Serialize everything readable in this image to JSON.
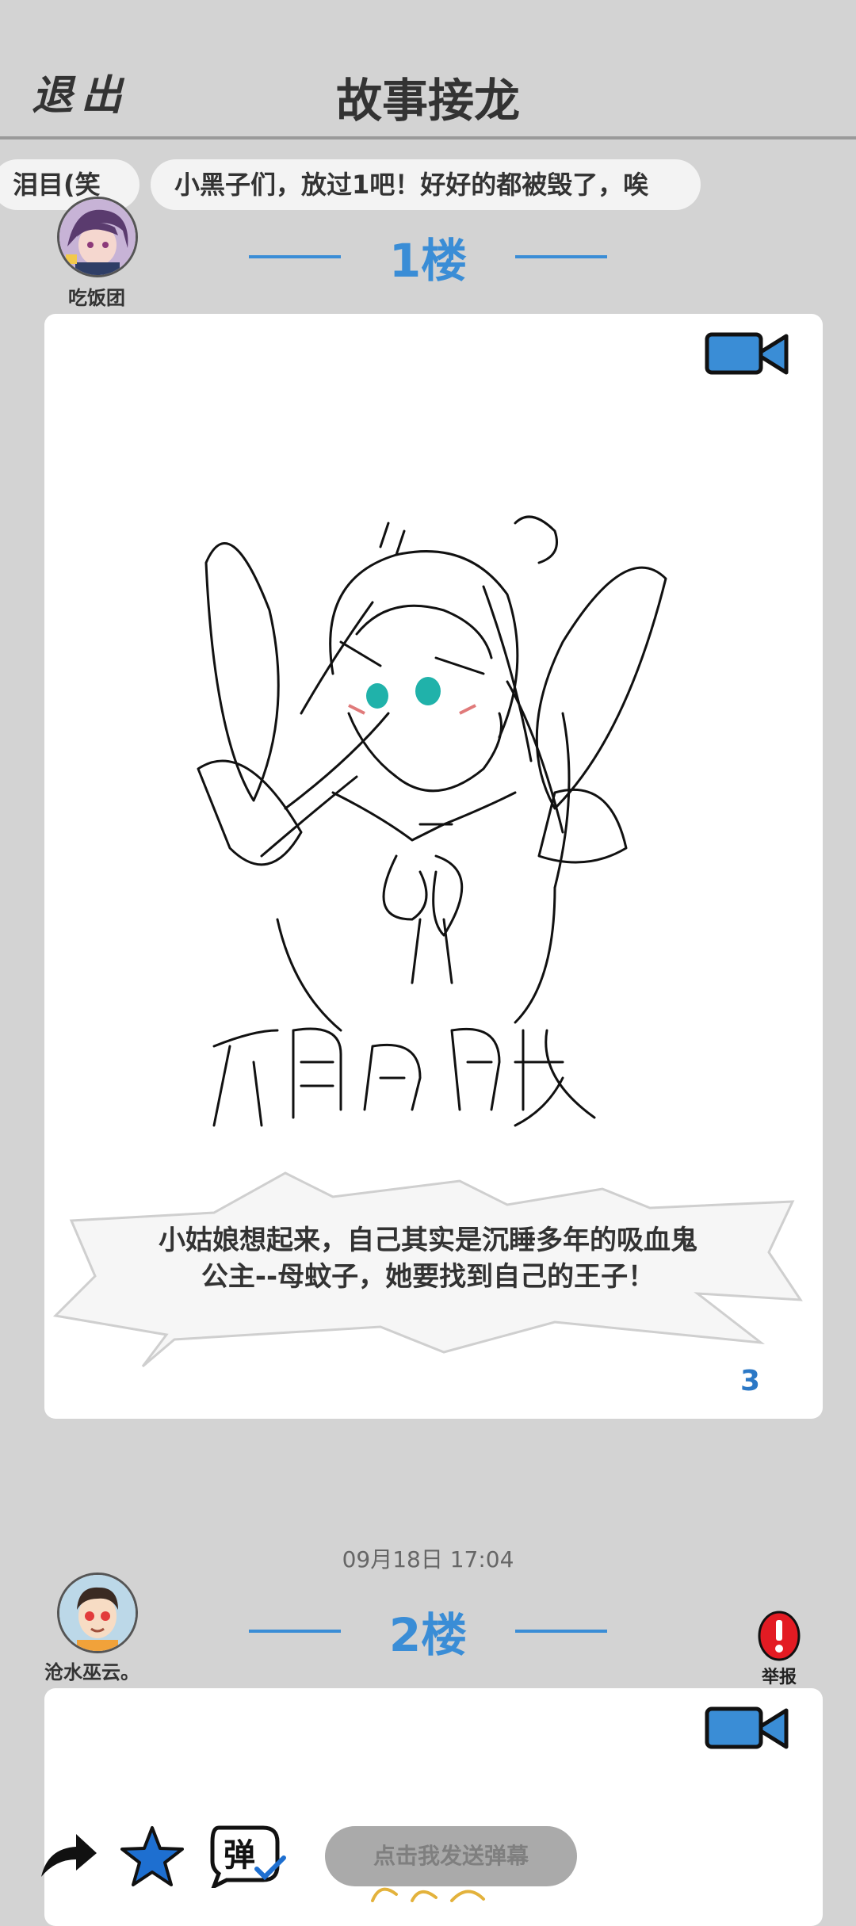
{
  "header": {
    "exit_label": "退出",
    "title": "故事接龙"
  },
  "danmaku": [
    "泪目(笑",
    "小黑子们，放过1吧！好好的都被毁了，唉"
  ],
  "floors": [
    {
      "username": "吃饭团",
      "floor_label": "1楼",
      "drawing_text": "希的睡魔",
      "caption_line1": "小姑娘想起来，自己其实是沉睡多年的吸血鬼",
      "caption_line2": "公主--母蚊子，她要找到自己的王子！",
      "page_count": "3"
    },
    {
      "timestamp": "09月18日  17:04",
      "username": "沧水巫云。",
      "floor_label": "2楼",
      "report_label": "举报"
    }
  ],
  "toolbar": {
    "send_danmaku_label": "点击我发送弹幕",
    "danmaku_toggle_glyph": "弹"
  },
  "colors": {
    "accent_blue": "#3a8dd6",
    "background": "#d3d3d3",
    "report_red": "#e31b23"
  },
  "icons": [
    "video-camera-icon",
    "share-icon",
    "star-icon",
    "danmaku-toggle-icon",
    "report-icon"
  ]
}
